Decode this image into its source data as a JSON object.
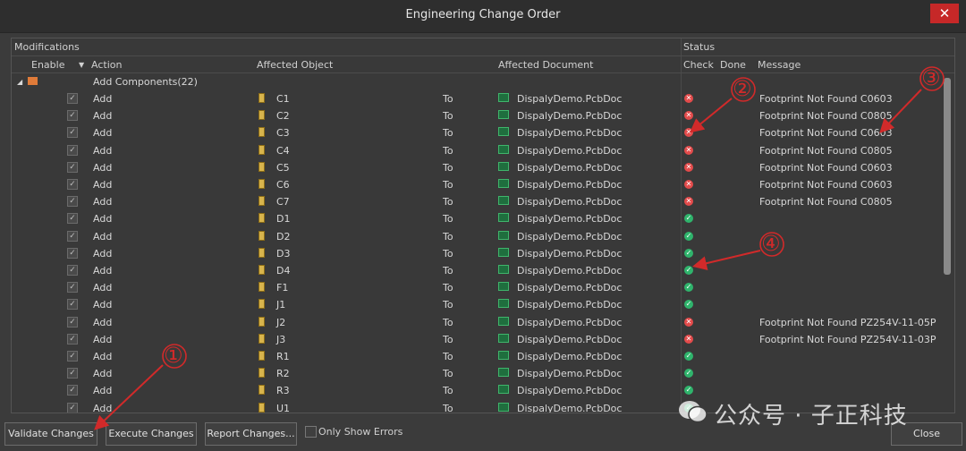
{
  "window": {
    "title": "Engineering Change Order",
    "close_glyph": "✕"
  },
  "header": {
    "group_modifications": "Modifications",
    "group_status": "Status",
    "columns": {
      "enable": "Enable",
      "action": "Action",
      "affected_object": "Affected Object",
      "affected_document": "Affected Document",
      "check": "Check",
      "done": "Done",
      "message": "Message"
    }
  },
  "group_row": {
    "label": "Add Components(22)"
  },
  "rows": [
    {
      "action": "Add",
      "object": "C1",
      "to": "To",
      "document": "DispalyDemo.PcbDoc",
      "check": "error",
      "message": "Footprint Not Found C0603"
    },
    {
      "action": "Add",
      "object": "C2",
      "to": "To",
      "document": "DispalyDemo.PcbDoc",
      "check": "error",
      "message": "Footprint Not Found C0805"
    },
    {
      "action": "Add",
      "object": "C3",
      "to": "To",
      "document": "DispalyDemo.PcbDoc",
      "check": "error",
      "message": "Footprint Not Found C0603"
    },
    {
      "action": "Add",
      "object": "C4",
      "to": "To",
      "document": "DispalyDemo.PcbDoc",
      "check": "error",
      "message": "Footprint Not Found C0805"
    },
    {
      "action": "Add",
      "object": "C5",
      "to": "To",
      "document": "DispalyDemo.PcbDoc",
      "check": "error",
      "message": "Footprint Not Found C0603"
    },
    {
      "action": "Add",
      "object": "C6",
      "to": "To",
      "document": "DispalyDemo.PcbDoc",
      "check": "error",
      "message": "Footprint Not Found C0603"
    },
    {
      "action": "Add",
      "object": "C7",
      "to": "To",
      "document": "DispalyDemo.PcbDoc",
      "check": "error",
      "message": "Footprint Not Found C0805"
    },
    {
      "action": "Add",
      "object": "D1",
      "to": "To",
      "document": "DispalyDemo.PcbDoc",
      "check": "ok",
      "message": ""
    },
    {
      "action": "Add",
      "object": "D2",
      "to": "To",
      "document": "DispalyDemo.PcbDoc",
      "check": "ok",
      "message": ""
    },
    {
      "action": "Add",
      "object": "D3",
      "to": "To",
      "document": "DispalyDemo.PcbDoc",
      "check": "ok",
      "message": ""
    },
    {
      "action": "Add",
      "object": "D4",
      "to": "To",
      "document": "DispalyDemo.PcbDoc",
      "check": "ok",
      "message": ""
    },
    {
      "action": "Add",
      "object": "F1",
      "to": "To",
      "document": "DispalyDemo.PcbDoc",
      "check": "ok",
      "message": ""
    },
    {
      "action": "Add",
      "object": "J1",
      "to": "To",
      "document": "DispalyDemo.PcbDoc",
      "check": "ok",
      "message": ""
    },
    {
      "action": "Add",
      "object": "J2",
      "to": "To",
      "document": "DispalyDemo.PcbDoc",
      "check": "error",
      "message": "Footprint Not Found PZ254V-11-05P"
    },
    {
      "action": "Add",
      "object": "J3",
      "to": "To",
      "document": "DispalyDemo.PcbDoc",
      "check": "error",
      "message": "Footprint Not Found PZ254V-11-03P"
    },
    {
      "action": "Add",
      "object": "R1",
      "to": "To",
      "document": "DispalyDemo.PcbDoc",
      "check": "ok",
      "message": ""
    },
    {
      "action": "Add",
      "object": "R2",
      "to": "To",
      "document": "DispalyDemo.PcbDoc",
      "check": "ok",
      "message": ""
    },
    {
      "action": "Add",
      "object": "R3",
      "to": "To",
      "document": "DispalyDemo.PcbDoc",
      "check": "ok",
      "message": ""
    },
    {
      "action": "Add",
      "object": "U1",
      "to": "To",
      "document": "DispalyDemo.PcbDoc",
      "check": "ok",
      "message": ""
    }
  ],
  "buttons": {
    "validate": "Validate Changes",
    "execute": "Execute Changes",
    "report": "Report Changes...",
    "close": "Close"
  },
  "only_show_errors": "Only Show Errors",
  "annotations": [
    "①",
    "②",
    "③",
    "④"
  ],
  "watermark": "公众号 · 子正科技",
  "colors": {
    "error": "#e34b4b",
    "ok": "#2fb46c",
    "annotation": "#d12a2a"
  }
}
